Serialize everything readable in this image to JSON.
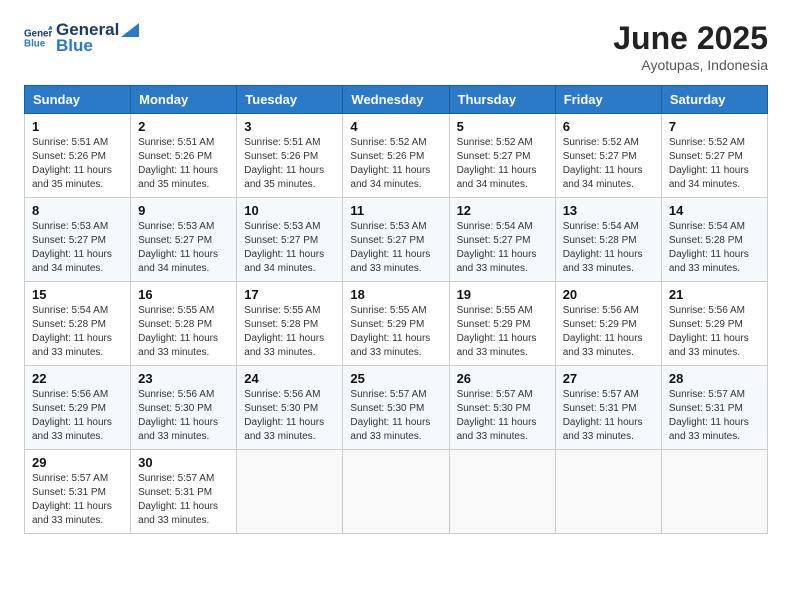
{
  "header": {
    "logo_line1": "General",
    "logo_line2": "Blue",
    "month_year": "June 2025",
    "location": "Ayotupas, Indonesia"
  },
  "weekdays": [
    "Sunday",
    "Monday",
    "Tuesday",
    "Wednesday",
    "Thursday",
    "Friday",
    "Saturday"
  ],
  "weeks": [
    [
      {
        "day": 1,
        "sunrise": "5:51 AM",
        "sunset": "5:26 PM",
        "daylight": "11 hours and 35 minutes."
      },
      {
        "day": 2,
        "sunrise": "5:51 AM",
        "sunset": "5:26 PM",
        "daylight": "11 hours and 35 minutes."
      },
      {
        "day": 3,
        "sunrise": "5:51 AM",
        "sunset": "5:26 PM",
        "daylight": "11 hours and 35 minutes."
      },
      {
        "day": 4,
        "sunrise": "5:52 AM",
        "sunset": "5:26 PM",
        "daylight": "11 hours and 34 minutes."
      },
      {
        "day": 5,
        "sunrise": "5:52 AM",
        "sunset": "5:27 PM",
        "daylight": "11 hours and 34 minutes."
      },
      {
        "day": 6,
        "sunrise": "5:52 AM",
        "sunset": "5:27 PM",
        "daylight": "11 hours and 34 minutes."
      },
      {
        "day": 7,
        "sunrise": "5:52 AM",
        "sunset": "5:27 PM",
        "daylight": "11 hours and 34 minutes."
      }
    ],
    [
      {
        "day": 8,
        "sunrise": "5:53 AM",
        "sunset": "5:27 PM",
        "daylight": "11 hours and 34 minutes."
      },
      {
        "day": 9,
        "sunrise": "5:53 AM",
        "sunset": "5:27 PM",
        "daylight": "11 hours and 34 minutes."
      },
      {
        "day": 10,
        "sunrise": "5:53 AM",
        "sunset": "5:27 PM",
        "daylight": "11 hours and 34 minutes."
      },
      {
        "day": 11,
        "sunrise": "5:53 AM",
        "sunset": "5:27 PM",
        "daylight": "11 hours and 33 minutes."
      },
      {
        "day": 12,
        "sunrise": "5:54 AM",
        "sunset": "5:27 PM",
        "daylight": "11 hours and 33 minutes."
      },
      {
        "day": 13,
        "sunrise": "5:54 AM",
        "sunset": "5:28 PM",
        "daylight": "11 hours and 33 minutes."
      },
      {
        "day": 14,
        "sunrise": "5:54 AM",
        "sunset": "5:28 PM",
        "daylight": "11 hours and 33 minutes."
      }
    ],
    [
      {
        "day": 15,
        "sunrise": "5:54 AM",
        "sunset": "5:28 PM",
        "daylight": "11 hours and 33 minutes."
      },
      {
        "day": 16,
        "sunrise": "5:55 AM",
        "sunset": "5:28 PM",
        "daylight": "11 hours and 33 minutes."
      },
      {
        "day": 17,
        "sunrise": "5:55 AM",
        "sunset": "5:28 PM",
        "daylight": "11 hours and 33 minutes."
      },
      {
        "day": 18,
        "sunrise": "5:55 AM",
        "sunset": "5:29 PM",
        "daylight": "11 hours and 33 minutes."
      },
      {
        "day": 19,
        "sunrise": "5:55 AM",
        "sunset": "5:29 PM",
        "daylight": "11 hours and 33 minutes."
      },
      {
        "day": 20,
        "sunrise": "5:56 AM",
        "sunset": "5:29 PM",
        "daylight": "11 hours and 33 minutes."
      },
      {
        "day": 21,
        "sunrise": "5:56 AM",
        "sunset": "5:29 PM",
        "daylight": "11 hours and 33 minutes."
      }
    ],
    [
      {
        "day": 22,
        "sunrise": "5:56 AM",
        "sunset": "5:29 PM",
        "daylight": "11 hours and 33 minutes."
      },
      {
        "day": 23,
        "sunrise": "5:56 AM",
        "sunset": "5:30 PM",
        "daylight": "11 hours and 33 minutes."
      },
      {
        "day": 24,
        "sunrise": "5:56 AM",
        "sunset": "5:30 PM",
        "daylight": "11 hours and 33 minutes."
      },
      {
        "day": 25,
        "sunrise": "5:57 AM",
        "sunset": "5:30 PM",
        "daylight": "11 hours and 33 minutes."
      },
      {
        "day": 26,
        "sunrise": "5:57 AM",
        "sunset": "5:30 PM",
        "daylight": "11 hours and 33 minutes."
      },
      {
        "day": 27,
        "sunrise": "5:57 AM",
        "sunset": "5:31 PM",
        "daylight": "11 hours and 33 minutes."
      },
      {
        "day": 28,
        "sunrise": "5:57 AM",
        "sunset": "5:31 PM",
        "daylight": "11 hours and 33 minutes."
      }
    ],
    [
      {
        "day": 29,
        "sunrise": "5:57 AM",
        "sunset": "5:31 PM",
        "daylight": "11 hours and 33 minutes."
      },
      {
        "day": 30,
        "sunrise": "5:57 AM",
        "sunset": "5:31 PM",
        "daylight": "11 hours and 33 minutes."
      },
      null,
      null,
      null,
      null,
      null
    ]
  ],
  "labels": {
    "sunrise": "Sunrise:",
    "sunset": "Sunset:",
    "daylight": "Daylight:"
  }
}
